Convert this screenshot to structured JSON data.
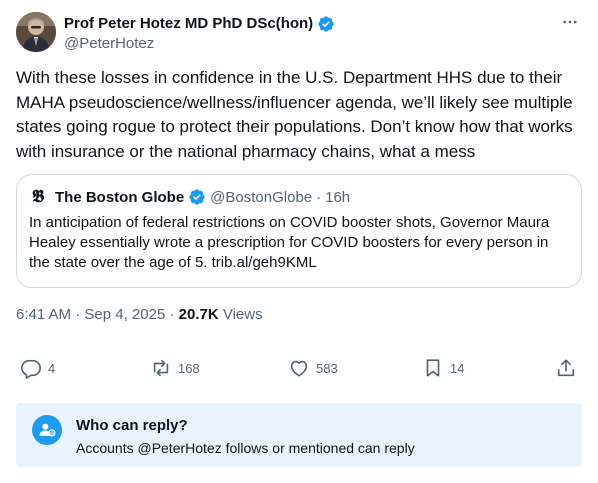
{
  "author": {
    "display_name": "Prof Peter Hotez MD PhD DSc(hon)",
    "handle": "@PeterHotez",
    "verified": true
  },
  "more_icon": "more-horizontal-icon",
  "tweet": {
    "text": "With these losses in confidence in the U.S. Department HHS due to their MAHA pseudoscience/wellness/influencer agenda, we’ll likely see multiple states going rogue to protect their populations. Don’t know how that works with insurance or the national pharmacy chains, what a mess"
  },
  "quote": {
    "logo": "𝕭",
    "name": "The Boston Globe",
    "handle": "@BostonGlobe",
    "separator": "·",
    "time": "16h",
    "text": "In anticipation of federal restrictions on COVID booster shots, Governor Maura Healey essentially wrote a prescription for COVID boosters for every person in the state over the age of 5. trib.al/geh9KML"
  },
  "meta": {
    "time": "6:41 AM",
    "dot": "·",
    "date": "Sep 4, 2025",
    "views_count": "20.7K",
    "views_label": "Views"
  },
  "actions": {
    "replies": "4",
    "reposts": "168",
    "likes": "583",
    "bookmarks": "14"
  },
  "reply_settings": {
    "title": "Who can reply?",
    "subtitle": "Accounts @PeterHotez follows or mentioned can reply"
  },
  "colors": {
    "accent": "#1d9bf0",
    "secondary_text": "#536471",
    "reply_box_bg": "#e8f4fd"
  }
}
